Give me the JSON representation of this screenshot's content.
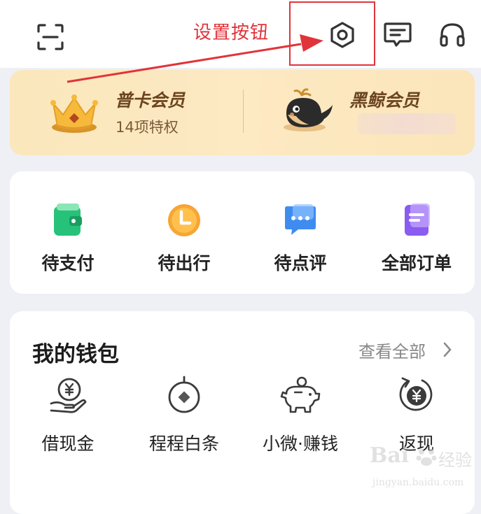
{
  "annotation": {
    "text": "设置按钮",
    "color": "#e0343a"
  },
  "header": {
    "icons": [
      "scan-icon",
      "settings-icon",
      "message-icon",
      "headset-icon"
    ]
  },
  "membership": {
    "left": {
      "title": "普卡会员",
      "subtitle": "14项特权",
      "icon": "crown-icon"
    },
    "right": {
      "title": "黑鲸会员",
      "icon": "whale-icon"
    }
  },
  "orders": {
    "items": [
      {
        "label": "待支付",
        "icon": "wallet-green-icon"
      },
      {
        "label": "待出行",
        "icon": "clock-orange-icon"
      },
      {
        "label": "待点评",
        "icon": "chat-blue-icon"
      },
      {
        "label": "全部订单",
        "icon": "document-purple-icon"
      }
    ]
  },
  "wallet": {
    "title": "我的钱包",
    "view_all": "查看全部",
    "items": [
      {
        "label": "借现金",
        "icon": "yuan-hand-icon"
      },
      {
        "label": "程程白条",
        "icon": "coin-circle-icon"
      },
      {
        "label": "小微·赚钱",
        "icon": "piggy-bank-icon"
      },
      {
        "label": "返现",
        "icon": "cashback-icon"
      }
    ]
  },
  "watermark": {
    "brand": "Bai",
    "suffix": "经验",
    "url": "jingyan.baidu.com"
  }
}
